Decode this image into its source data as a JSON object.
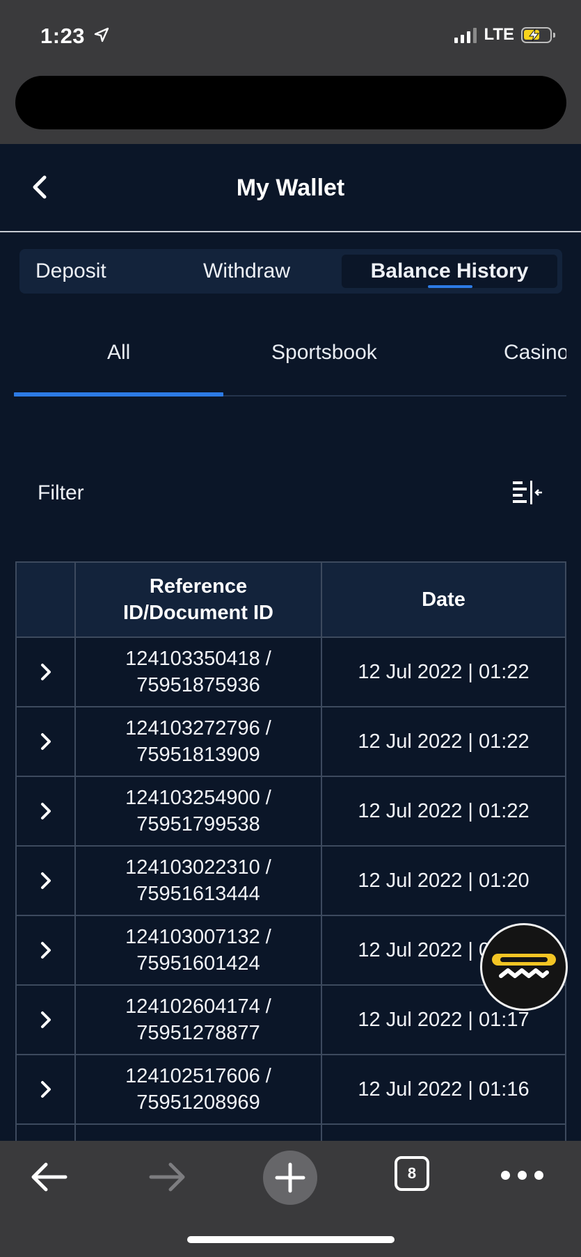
{
  "status_bar": {
    "time": "1:23",
    "network": "LTE"
  },
  "header": {
    "title": "My Wallet"
  },
  "tabs": [
    {
      "label": "Deposit",
      "active": false
    },
    {
      "label": "Withdraw",
      "active": false
    },
    {
      "label": "Balance History",
      "active": true
    }
  ],
  "sub_tabs": [
    {
      "label": "All",
      "active": true
    },
    {
      "label": "Sportsbook",
      "active": false
    },
    {
      "label": "Casino",
      "active": false
    }
  ],
  "filter": {
    "label": "Filter"
  },
  "table": {
    "headers": [
      "",
      "Reference ID/Document ID",
      "Date"
    ],
    "header_ref_line1": "Reference",
    "header_ref_line2": "ID/Document ID",
    "rows": [
      {
        "ref": "124103350418 /",
        "doc": "75951875936",
        "date": "12 Jul 2022 | 01:22"
      },
      {
        "ref": "124103272796 /",
        "doc": "75951813909",
        "date": "12 Jul 2022 | 01:22"
      },
      {
        "ref": "124103254900 /",
        "doc": "75951799538",
        "date": "12 Jul 2022 | 01:22"
      },
      {
        "ref": "124103022310 /",
        "doc": "75951613444",
        "date": "12 Jul 2022 | 01:20"
      },
      {
        "ref": "124103007132 /",
        "doc": "75951601424",
        "date": "12 Jul 2022 | 01:20"
      },
      {
        "ref": "124102604174 /",
        "doc": "75951278877",
        "date": "12 Jul 2022 | 01:17"
      },
      {
        "ref": "124102517606 /",
        "doc": "75951208969",
        "date": "12 Jul 2022 | 01:16"
      }
    ]
  },
  "browser_bar": {
    "tab_count": "8"
  },
  "colors": {
    "background": "#0b1628",
    "panel": "#13233b",
    "accent": "#2d7be5",
    "chrome": "#3a3a3c"
  },
  "icons": [
    "location-arrow-icon",
    "signal-icon",
    "battery-charging-icon",
    "chevron-left-icon",
    "filter-icon",
    "chevron-right-icon",
    "chat-icon",
    "arrow-left-icon",
    "arrow-right-icon",
    "plus-icon",
    "tabs-icon",
    "more-icon"
  ]
}
